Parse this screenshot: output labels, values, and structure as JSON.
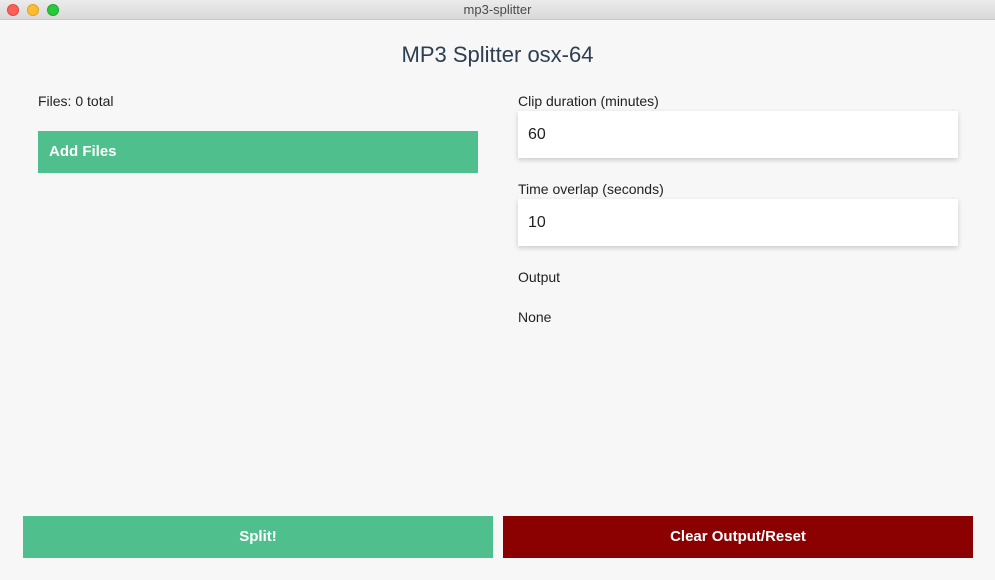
{
  "window": {
    "title": "mp3-splitter"
  },
  "app": {
    "title": "MP3 Splitter osx-64"
  },
  "files": {
    "count_label": "Files: 0 total",
    "add_button_label": "Add Files"
  },
  "settings": {
    "clip_duration_label": "Clip duration (minutes)",
    "clip_duration_value": "60",
    "time_overlap_label": "Time overlap (seconds)",
    "time_overlap_value": "10"
  },
  "output": {
    "label": "Output",
    "value": "None"
  },
  "actions": {
    "split_label": "Split!",
    "reset_label": "Clear Output/Reset"
  },
  "colors": {
    "primary_green": "#4fc08d",
    "danger_red": "#8b0000",
    "title_text": "#2c3e50"
  }
}
